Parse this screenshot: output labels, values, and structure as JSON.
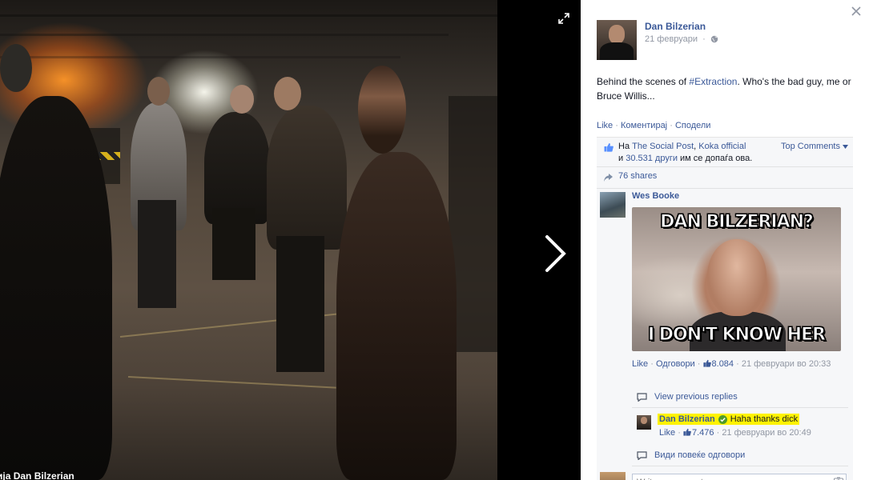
{
  "photo": {
    "caption": "ија Dan Bilzerian"
  },
  "post": {
    "author": "Dan Bilzerian",
    "date": "21 февруари",
    "text_prefix": "Behind the scenes of ",
    "hashtag": "#Extraction",
    "text_suffix": ". Who's the bad guy, me or Bruce Willis...",
    "actions": {
      "like": "Like",
      "comment": "Коментирај",
      "share": "Сподели"
    }
  },
  "likes": {
    "prefix": "На ",
    "liker_1": "The Social Post",
    "separator": ", ",
    "liker_2": "Koka official",
    "and": "и ",
    "others": "30.531 други",
    "suffix": " им се допаѓа ова.",
    "top_comments": "Top Comments",
    "shares": "76 shares"
  },
  "comment": {
    "author": "Wes Booke",
    "meme_top": "DAN BILZERIAN?",
    "meme_bottom": "I DON'T KNOW HER",
    "like": "Like",
    "reply": "Одговори",
    "like_count": "8.084",
    "timestamp": "21 февруари во 20:33",
    "view_previous": "View previous replies"
  },
  "reply": {
    "author": "Dan Bilzerian",
    "text": "Haha thanks dick",
    "like": "Like",
    "like_count": "7.476",
    "timestamp": "21 февруари во 20:49",
    "view_more": "Види повеќе одговори"
  },
  "composer": {
    "placeholder": "Write a comment..."
  },
  "colors": {
    "link": "#3b5998",
    "highlight": "#fff200",
    "panel_bg": "#f6f7f9"
  }
}
